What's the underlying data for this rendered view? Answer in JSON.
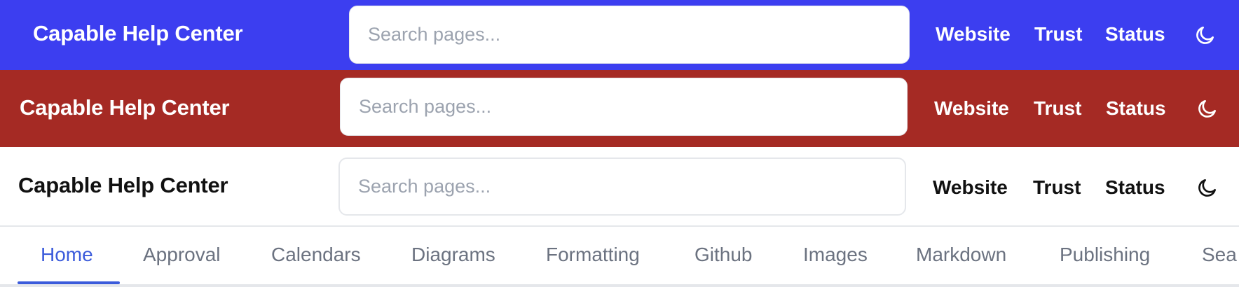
{
  "headers": [
    {
      "theme": "blue",
      "background": "#3c3ef0",
      "brand": "Capable Help Center",
      "search_placeholder": "Search pages...",
      "nav": [
        "Website",
        "Trust",
        "Status"
      ],
      "toggle_icon": "moon-icon"
    },
    {
      "theme": "red",
      "background": "#a52a24",
      "brand": "Capable Help Center",
      "search_placeholder": "Search pages...",
      "nav": [
        "Website",
        "Trust",
        "Status"
      ],
      "toggle_icon": "moon-icon"
    },
    {
      "theme": "white",
      "background": "#ffffff",
      "brand": "Capable Help Center",
      "search_placeholder": "Search pages...",
      "nav": [
        "Website",
        "Trust",
        "Status"
      ],
      "toggle_icon": "moon-icon"
    }
  ],
  "tabs": {
    "active": "Home",
    "accent": "#3b5bdb",
    "items": [
      "Home",
      "Approval",
      "Calendars",
      "Diagrams",
      "Formatting",
      "Github",
      "Images",
      "Markdown",
      "Publishing",
      "Sea"
    ]
  }
}
